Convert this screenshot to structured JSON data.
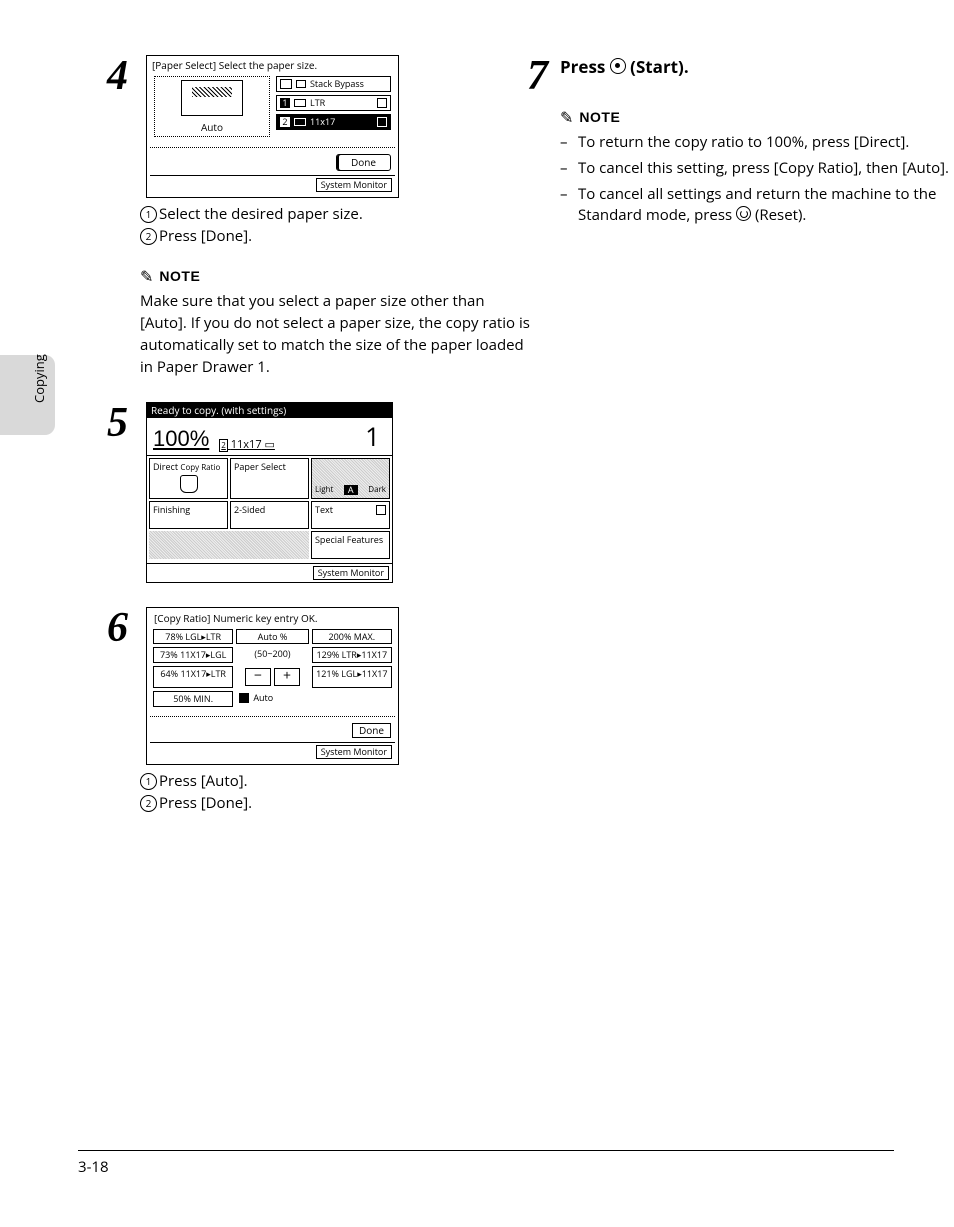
{
  "sidebar": {
    "label": "Copying"
  },
  "footer": {
    "page": "3-18"
  },
  "left": {
    "step4": {
      "num": "4",
      "title": "[Paper Select] Select the paper size.",
      "auto": "Auto",
      "stack": "Stack Bypass",
      "r1": "LTR",
      "r2": "11x17",
      "num1": "1",
      "num2": "2",
      "done": "Done",
      "sysmon": "System Monitor",
      "inst1": "Select the desired paper size.",
      "inst2": "Press [Done].",
      "notelabel": "NOTE",
      "notebody": "Make sure that you select a paper size other than [Auto]. If you do not select a paper size, the copy ratio is automatically set to match the size of the paper loaded in Paper Drawer 1."
    },
    "step5": {
      "num": "5",
      "title": "Ready to copy. (with settings)",
      "pct": "100%",
      "size": "11x17",
      "one": "1",
      "direct": "Direct",
      "copyratio": "Copy Ratio",
      "paperselect": "Paper Select",
      "light": "Light",
      "a": "A",
      "dark": "Dark",
      "finishing": "Finishing",
      "twosided": "2-Sided",
      "text": "Text",
      "special": "Special Features",
      "sysmon": "System Monitor"
    },
    "step6": {
      "num": "6",
      "title": "[Copy Ratio] Numeric key entry OK.",
      "r78": "78% LGL▸LTR",
      "autoPct": "Auto %",
      "r200": "200% MAX.",
      "r73": "73% 11X17▸LGL",
      "range": "(50~200)",
      "r129": "129% LTR▸11X17",
      "r64": "64% 11X17▸LTR",
      "r121": "121% LGL▸11X17",
      "r50": "50% MIN.",
      "auto": "Auto",
      "done": "Done",
      "sysmon": "System Monitor",
      "inst1": "Press [Auto].",
      "inst2": "Press [Done]."
    }
  },
  "right": {
    "step7": {
      "num": "7",
      "heading_a": "Press ",
      "heading_b": " (Start).",
      "notelabel": "NOTE",
      "n1": "To return the copy ratio to 100%, press [Direct].",
      "n2": "To cancel this setting, press [Copy Ratio], then [Auto].",
      "n3a": "To cancel all settings and return the machine to the Standard mode, press ",
      "n3b": " (Reset)."
    }
  }
}
